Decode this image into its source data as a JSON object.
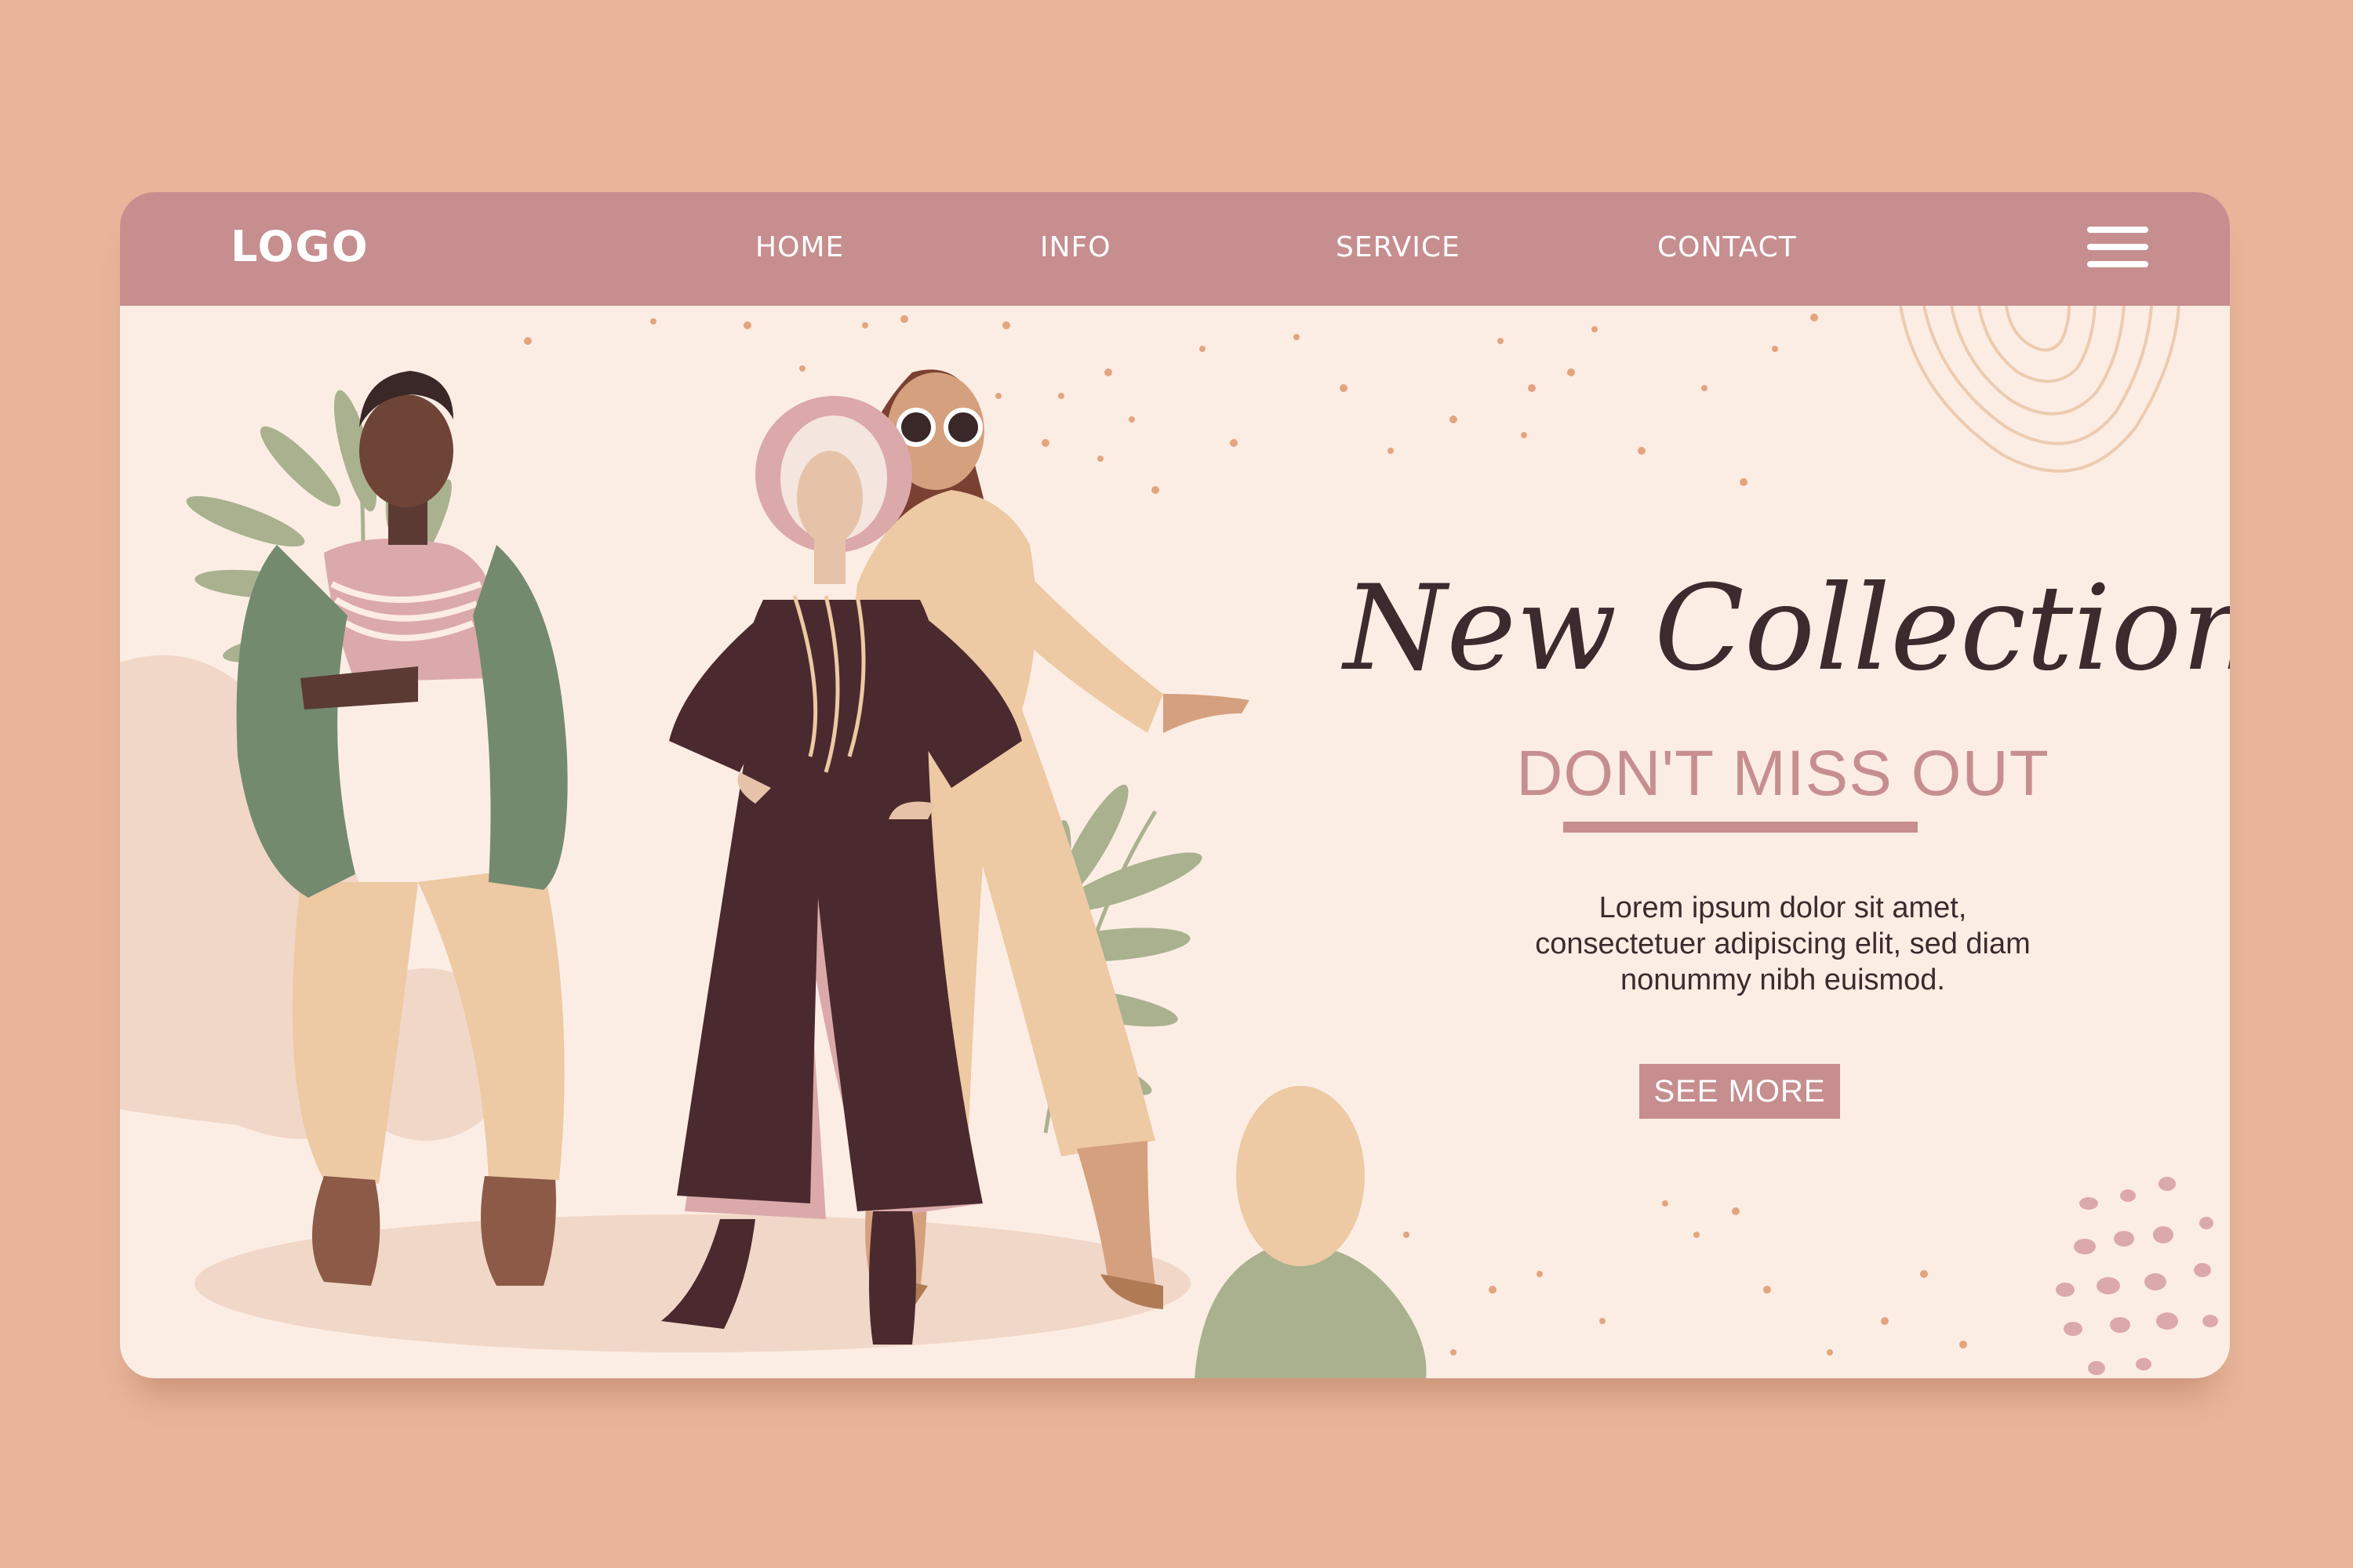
{
  "nav": {
    "logo": "LOGO",
    "items": [
      {
        "label": "HOME"
      },
      {
        "label": "INFO"
      },
      {
        "label": "SERVICE"
      },
      {
        "label": "CONTACT"
      }
    ],
    "menu_icon": "hamburger-menu-icon"
  },
  "hero": {
    "title": "New Collection",
    "subtitle": "DON'T MISS OUT",
    "body_lines": [
      "Lorem ipsum dolor sit amet,",
      "consectetuer adipiscing elit, sed diam",
      "nonummy nibh euismod."
    ],
    "cta_label": "SEE MORE"
  },
  "colors": {
    "page_background": "#e8b59a",
    "card_background": "#fcede4",
    "accent": "#c78e8f",
    "text_dark": "#3d2a2e",
    "sage": "#a9b18f",
    "beige": "#edc9a4",
    "plum": "#4a2a2e"
  }
}
